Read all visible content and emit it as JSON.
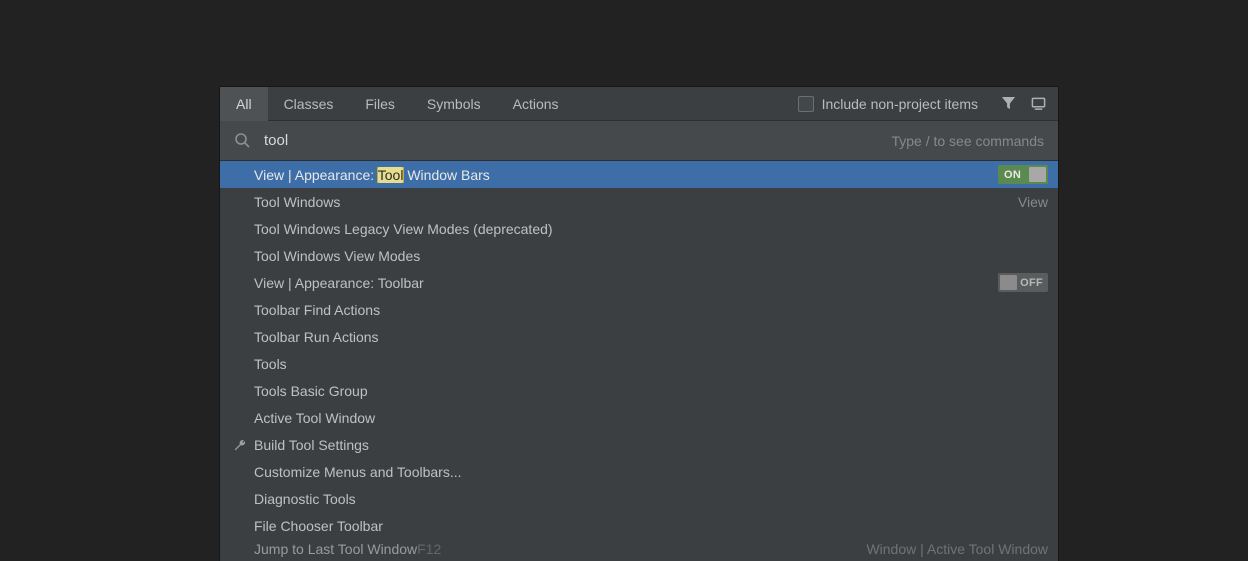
{
  "tabs": {
    "all": "All",
    "classes": "Classes",
    "files": "Files",
    "symbols": "Symbols",
    "actions": "Actions"
  },
  "include_label": "Include non-project items",
  "search": {
    "value": "tool",
    "hint": "Type / to see commands"
  },
  "results": [
    {
      "prefix": "View | Appearance: ",
      "hl": "Tool",
      "suffix": " Window Bars",
      "toggle": "ON"
    },
    {
      "label": "Tool Windows",
      "right": "View"
    },
    {
      "label": "Tool Windows Legacy View Modes (deprecated)"
    },
    {
      "label": "Tool Windows View Modes"
    },
    {
      "label": "View | Appearance: Toolbar",
      "toggle": "OFF"
    },
    {
      "label": "Toolbar Find Actions"
    },
    {
      "label": "Toolbar Run Actions"
    },
    {
      "label": "Tools"
    },
    {
      "label": "Tools Basic Group"
    },
    {
      "label": "Active Tool Window"
    },
    {
      "label": "Build Tool Settings",
      "icon": "wrench"
    },
    {
      "label": "Customize Menus and Toolbars..."
    },
    {
      "label": "Diagnostic Tools"
    },
    {
      "label": "File Chooser Toolbar"
    },
    {
      "label": "Jump to Last Tool Window",
      "shortcut": "F12",
      "right": "Window | Active Tool Window",
      "partial": true
    }
  ]
}
